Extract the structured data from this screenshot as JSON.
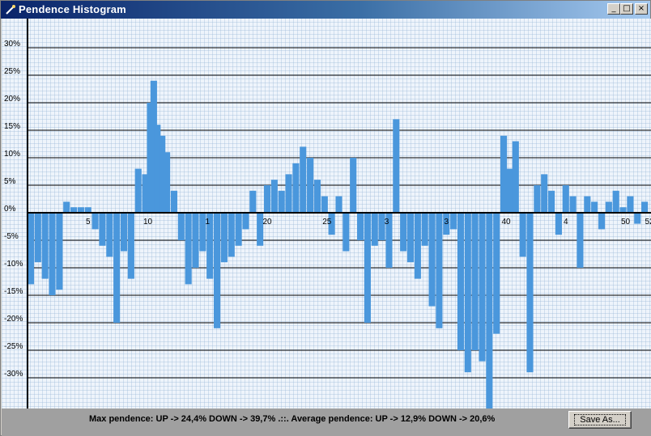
{
  "window": {
    "title": "Pendence Histogram",
    "controls": {
      "minimize": "_",
      "maximize": "□",
      "close": "×"
    }
  },
  "footer": {
    "summary": "Max pendence: UP -> 24,4% DOWN -> 39,7% .::. Average pendence: UP -> 12,9% DOWN -> 20,6%",
    "save_label": "Save As..."
  },
  "chart_data": {
    "type": "bar",
    "ylim": [
      -35,
      34
    ],
    "xlim": [
      0,
      52
    ],
    "grid": true,
    "y_ticks": [
      30,
      25,
      20,
      15,
      10,
      5,
      0,
      -5,
      -10,
      -15,
      -20,
      -25,
      -30
    ],
    "y_tick_labels": [
      "30%",
      "25%",
      "20%",
      "15%",
      "10%",
      "5%",
      "0%",
      "-5%",
      "-10%",
      "-15%",
      "-20%",
      "-25%",
      "-30%"
    ],
    "x_ticks": [
      5,
      10,
      15,
      20,
      25,
      30,
      35,
      40,
      45,
      50,
      52
    ],
    "x_tick_labels": [
      "5",
      "10",
      "1",
      "20",
      "25",
      "3",
      "3",
      "40",
      "4",
      "50",
      "52"
    ],
    "series": [
      {
        "color": "#4a97dc",
        "x": [
          0.2,
          0.8,
          1.4,
          2.0,
          2.6,
          3.2,
          3.8,
          4.4,
          5.0,
          5.6,
          6.2,
          6.8,
          7.4,
          8.0,
          8.6,
          9.2,
          9.8,
          10.2,
          10.5,
          10.8,
          11.2,
          11.6,
          12.2,
          12.8,
          13.4,
          14.0,
          14.6,
          15.2,
          15.8,
          16.4,
          17.0,
          17.6,
          18.2,
          18.8,
          19.4,
          20.0,
          20.6,
          21.2,
          21.8,
          22.4,
          23.0,
          23.6,
          24.2,
          24.8,
          25.4,
          26.0,
          26.6,
          27.2,
          27.8,
          28.4,
          29.0,
          29.6,
          30.2,
          30.8,
          31.4,
          32.0,
          32.6,
          33.2,
          33.8,
          34.4,
          35.0,
          35.6,
          36.2,
          36.8,
          37.4,
          38.0,
          38.6,
          39.2,
          39.8,
          40.3,
          40.8,
          41.4,
          42.0,
          42.6,
          43.2,
          43.8,
          44.4,
          45.0,
          45.6,
          46.2,
          46.8,
          47.4,
          48.0,
          48.6,
          49.2,
          49.8,
          50.4,
          51.0,
          51.6
        ],
        "values": [
          -13,
          -9,
          -12,
          -15,
          -14,
          2,
          1,
          1,
          1,
          -3,
          -6,
          -8,
          -20,
          -7,
          -12,
          8,
          7,
          20,
          24,
          16,
          14,
          11,
          4,
          -5,
          -13,
          -10,
          -7,
          -12,
          -21,
          -9,
          -8,
          -6,
          -3,
          4,
          -6,
          5,
          6,
          4,
          7,
          9,
          12,
          10,
          6,
          3,
          -4,
          3,
          -7,
          10,
          -5,
          -20,
          -6,
          -5,
          -10,
          17,
          -7,
          -9,
          -12,
          -6,
          -17,
          -21,
          -4,
          -3,
          -25,
          -29,
          -25,
          -27,
          -39,
          -22,
          14,
          8,
          13,
          -8,
          -29,
          5,
          7,
          4,
          -4,
          5,
          3,
          -10,
          3,
          2,
          -3,
          2,
          4,
          1,
          3,
          -2,
          2
        ]
      }
    ]
  }
}
